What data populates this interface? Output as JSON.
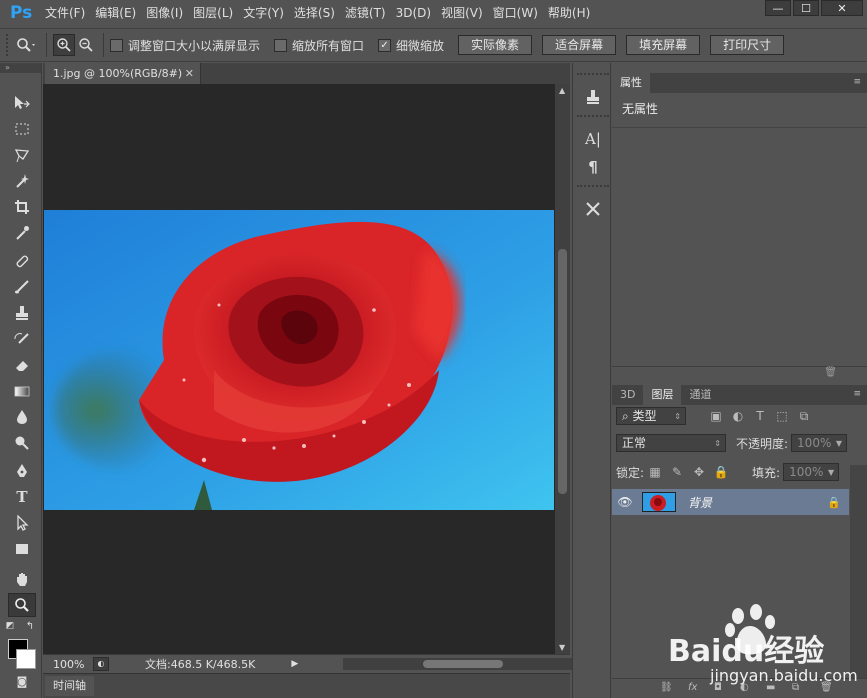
{
  "app": {
    "logo": "Ps",
    "menu": [
      "文件(F)",
      "编辑(E)",
      "图像(I)",
      "图层(L)",
      "文字(Y)",
      "选择(S)",
      "滤镜(T)",
      "3D(D)",
      "视图(V)",
      "窗口(W)",
      "帮助(H)"
    ],
    "window_controls": [
      "—",
      "☐",
      "✕"
    ]
  },
  "options_bar": {
    "checkboxes": [
      {
        "label": "调整窗口大小以满屏显示",
        "checked": false
      },
      {
        "label": "缩放所有窗口",
        "checked": false
      },
      {
        "label": "细微缩放",
        "checked": true
      }
    ],
    "buttons": [
      "实际像素",
      "适合屏幕",
      "填充屏幕",
      "打印尺寸"
    ]
  },
  "document": {
    "tab_title": "1.jpg @ 100%(RGB/8#)",
    "zoom": "100%",
    "doc_size": "文档:468.5 K/468.5K",
    "timeline_label": "时间轴"
  },
  "properties_panel": {
    "tab": "属性",
    "text": "无属性"
  },
  "layers_panel": {
    "tabs": [
      "3D",
      "图层",
      "通道"
    ],
    "active_tab": "图层",
    "filter_label": "类型",
    "blend_mode": "正常",
    "opacity_label": "不透明度:",
    "opacity_value": "100%",
    "lock_label": "锁定:",
    "fill_label": "填充:",
    "fill_value": "100%",
    "layers": [
      {
        "name": "背景",
        "visible": true,
        "locked": true
      }
    ]
  },
  "watermark": {
    "brand": "Baidu经验",
    "url": "jingyan.baidu.com"
  },
  "colors": {
    "accent": "#2fa3f5",
    "selected_layer": "#6b7b94"
  }
}
